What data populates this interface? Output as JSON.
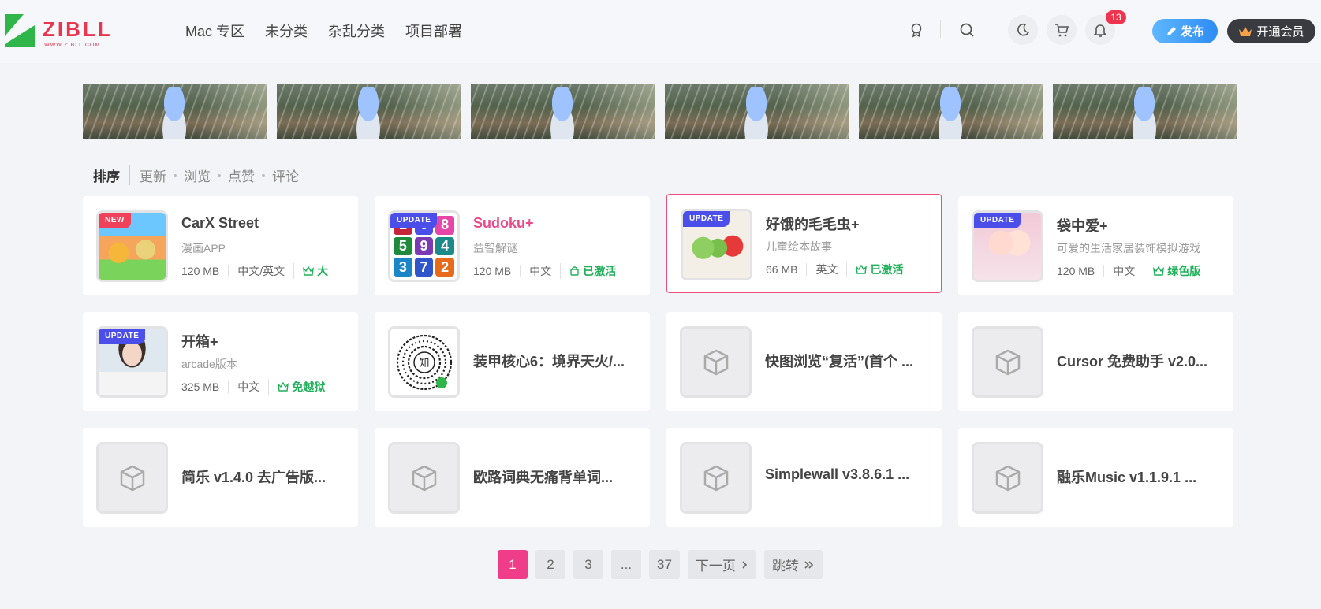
{
  "header": {
    "logo_text": "ZIBLL",
    "logo_sub": "WWW.ZIBLL.COM",
    "nav": [
      "Mac 专区",
      "未分类",
      "杂乱分类",
      "项目部署"
    ],
    "notification_count": "13",
    "publish_label": "发布",
    "vip_label": "开通会员",
    "icons": [
      "badge-icon",
      "search-icon",
      "moon-icon",
      "cart-icon",
      "bell-icon"
    ]
  },
  "sort": {
    "title": "排序",
    "options": [
      "更新",
      "浏览",
      "点赞",
      "评论"
    ]
  },
  "cards": [
    {
      "title": "CarX Street",
      "subtitle": "漫画APP",
      "size": "120 MB",
      "lang": "中文/英文",
      "status": "大",
      "tag": "NEW",
      "art": "carx",
      "title_color": "default"
    },
    {
      "title": "Sudoku+",
      "subtitle": "益智解谜",
      "size": "120 MB",
      "lang": "中文",
      "status": "已激活",
      "tag": "UPDATE",
      "art": "sudoku",
      "title_color": "pink"
    },
    {
      "title": "好饿的毛毛虫+",
      "subtitle": "儿童绘本故事",
      "size": "66 MB",
      "lang": "英文",
      "status": "已激活",
      "tag": "UPDATE",
      "art": "caterpillar",
      "title_color": "default"
    },
    {
      "title": "袋中爱+",
      "subtitle": "可爱的生活家居装饰模拟游戏",
      "size": "120 MB",
      "lang": "中文",
      "status": "绿色版",
      "tag": "UPDATE",
      "art": "girls",
      "title_color": "default"
    },
    {
      "title": "开箱+",
      "subtitle": "arcade版本",
      "size": "325 MB",
      "lang": "中文",
      "status": "免越狱",
      "tag": "UPDATE",
      "art": "photo",
      "title_color": "default"
    },
    {
      "title": "装甲核心6：境界天火/...",
      "art": "qr"
    },
    {
      "title": "快图浏览“复活”(首个 ...",
      "art": "box"
    },
    {
      "title": "Cursor 免费助手 v2.0...",
      "art": "box"
    },
    {
      "title": "简乐 v1.4.0 去广告版...",
      "art": "box"
    },
    {
      "title": "欧路词典无痛背单词...",
      "art": "box"
    },
    {
      "title": "Simplewall v3.8.6.1 ...",
      "art": "box"
    },
    {
      "title": "融乐Music v1.1.9.1 ...",
      "art": "box"
    }
  ],
  "sudoku_digits": [
    "1",
    "6",
    "8",
    "5",
    "9",
    "4",
    "3",
    "7",
    "2"
  ],
  "sudoku_colors": [
    "#c5243d",
    "#4b4ee8",
    "#e845a8",
    "#1d8a3c",
    "#7b3ab3",
    "#1d8a8a",
    "#1b86c7",
    "#3054c9",
    "#e86b1c"
  ],
  "qr_label": "知",
  "pagination": {
    "pages": [
      "1",
      "2",
      "3",
      "...",
      "37"
    ],
    "current": "1",
    "next_label": "下一页",
    "jump_label": "跳转"
  },
  "colors": {
    "accent_pink": "#ef3d8a",
    "status_green": "#20b05a",
    "update_tag": "#4b4ee8",
    "new_tag": "#f0405a"
  }
}
